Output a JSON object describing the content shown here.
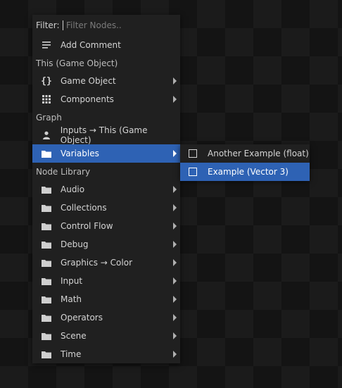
{
  "filter": {
    "label": "Filter:",
    "placeholder": "Filter Nodes.."
  },
  "add_comment": {
    "label": "Add Comment",
    "icon": "comment-lines-icon"
  },
  "sections": {
    "this": "This (Game Object)",
    "graph": "Graph",
    "node_library": "Node Library"
  },
  "this_items": [
    {
      "label": "Game Object",
      "icon": "braces-icon"
    },
    {
      "label": "Components",
      "icon": "grid-icon"
    }
  ],
  "graph_items": [
    {
      "label": "Inputs → This (Game Object)",
      "icon": "person-icon"
    },
    {
      "label": "Variables",
      "icon": "folder-icon",
      "selected": true
    }
  ],
  "library_items": [
    {
      "label": "Audio"
    },
    {
      "label": "Collections"
    },
    {
      "label": "Control Flow"
    },
    {
      "label": "Debug"
    },
    {
      "label": "Graphics → Color"
    },
    {
      "label": "Input"
    },
    {
      "label": "Math"
    },
    {
      "label": "Operators"
    },
    {
      "label": "Scene"
    },
    {
      "label": "Time"
    }
  ],
  "variables_submenu": [
    {
      "label": "Another Example (float)"
    },
    {
      "label": "Example (Vector 3)",
      "selected": true
    }
  ],
  "colors": {
    "accent": "#2e62b4",
    "panel": "#202020"
  }
}
